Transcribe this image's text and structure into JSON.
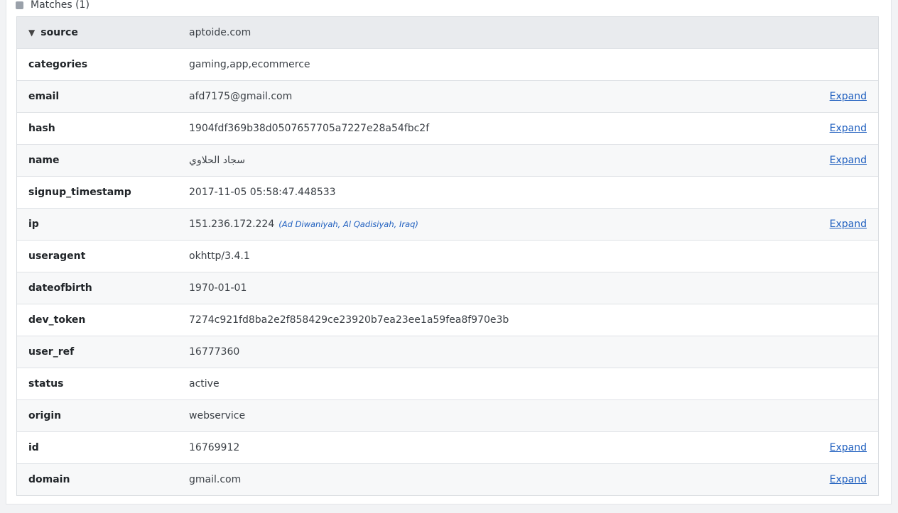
{
  "matches": {
    "label": "Matches (1)"
  },
  "record": {
    "header": {
      "key": "source",
      "value": "aptoide.com"
    },
    "expand_label": "Expand",
    "rows": [
      {
        "key": "categories",
        "value": "gaming,app,ecommerce",
        "expandable": false
      },
      {
        "key": "email",
        "value": "afd7175@gmail.com",
        "expandable": true
      },
      {
        "key": "hash",
        "value": "1904fdf369b38d0507657705a7227e28a54fbc2f",
        "expandable": true
      },
      {
        "key": "name",
        "value": "سجاد الحلاوي",
        "expandable": true
      },
      {
        "key": "signup_timestamp",
        "value": "2017-11-05 05:58:47.448533",
        "expandable": false
      },
      {
        "key": "ip",
        "value": "151.236.172.224",
        "geo": "(Ad Diwaniyah, Al Qadisiyah, Iraq)",
        "expandable": true
      },
      {
        "key": "useragent",
        "value": "okhttp/3.4.1",
        "expandable": false
      },
      {
        "key": "dateofbirth",
        "value": "1970-01-01",
        "expandable": false
      },
      {
        "key": "dev_token",
        "value": "7274c921fd8ba2e2f858429ce23920b7ea23ee1a59fea8f970e3b",
        "expandable": false
      },
      {
        "key": "user_ref",
        "value": "16777360",
        "expandable": false
      },
      {
        "key": "status",
        "value": "active",
        "expandable": false
      },
      {
        "key": "origin",
        "value": "webservice",
        "expandable": false
      },
      {
        "key": "id",
        "value": "16769912",
        "expandable": true
      },
      {
        "key": "domain",
        "value": "gmail.com",
        "expandable": true
      }
    ]
  },
  "colors": {
    "link": "#1f5fbf",
    "header_bg": "#e9ebee",
    "alt_row_bg": "#f7f8f9"
  }
}
